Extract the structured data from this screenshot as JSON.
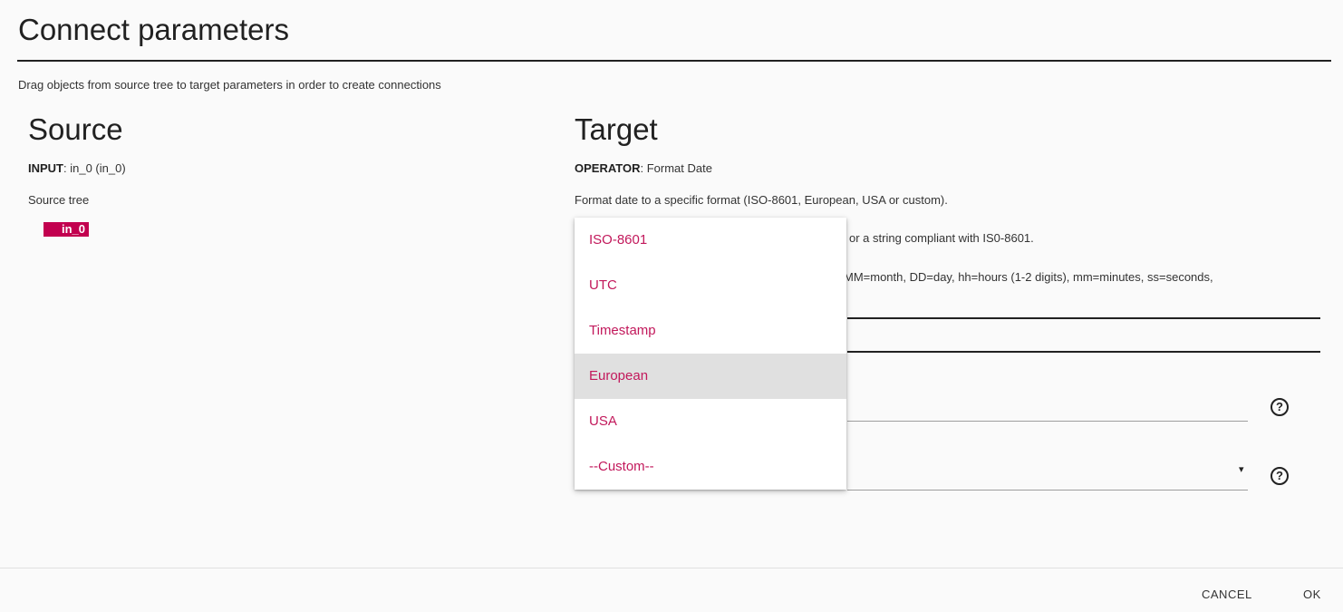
{
  "dialog": {
    "title": "Connect parameters",
    "subtitle": "Drag objects from source tree to target parameters in order to create connections"
  },
  "source": {
    "heading": "Source",
    "input_label": "INPUT",
    "input_value": ": in_0 (in_0)",
    "tree_label": "Source tree",
    "tree_nodes": [
      "in_0"
    ]
  },
  "target": {
    "heading": "Target",
    "operator_label": "OPERATOR",
    "operator_value": ": Format Date",
    "description": "Format date to a specific format (ISO-8601, European, USA or custom).",
    "partial_line_1": "or a string compliant with IS0-8601.",
    "partial_line_2": "MM=month, DD=day, hh=hours (1-2 digits), mm=minutes, ss=seconds,",
    "help_icon_glyph": "?",
    "select_arrow_glyph": "▾"
  },
  "dropdown": {
    "options": [
      "ISO-8601",
      "UTC",
      "Timestamp",
      "European",
      "USA",
      "--Custom--"
    ],
    "highlighted": "European",
    "color": "#c2185b"
  },
  "footer": {
    "cancel_label": "CANCEL",
    "ok_label": "OK"
  },
  "colors": {
    "accent": "#c2004f",
    "background": "#fafafa"
  }
}
